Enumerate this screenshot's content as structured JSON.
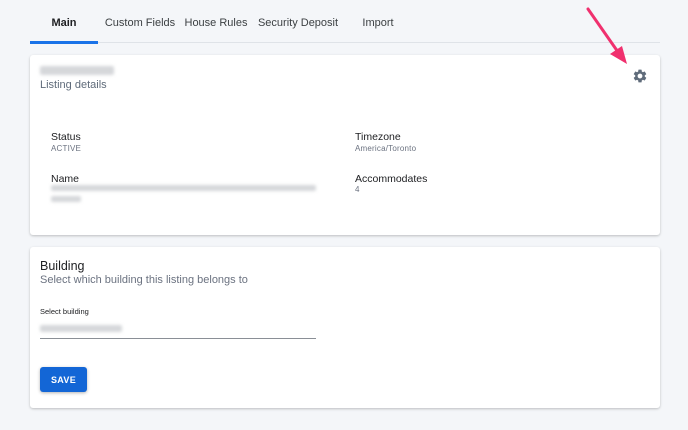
{
  "tabs": [
    {
      "label": "Main",
      "active": true
    },
    {
      "label": "Custom Fields",
      "active": false
    },
    {
      "label": "House Rules",
      "active": false
    },
    {
      "label": "Security Deposit",
      "active": false
    },
    {
      "label": "Import",
      "active": false
    }
  ],
  "listing": {
    "subtitle": "Listing details",
    "settings_icon": "gear-icon",
    "fields": {
      "status": {
        "label": "Status",
        "value": "ACTIVE"
      },
      "timezone": {
        "label": "Timezone",
        "value": "America/Toronto"
      },
      "name": {
        "label": "Name"
      },
      "accommodates": {
        "label": "Accommodates",
        "value": "4"
      }
    }
  },
  "building": {
    "title": "Building",
    "subtitle": "Select which building this listing belongs to",
    "select_label": "Select building",
    "save_label": "SAVE"
  },
  "colors": {
    "accent": "#1a73e8",
    "save_button": "#1366d6",
    "annotation_arrow": "#f0306e",
    "background": "#f4f6f9"
  }
}
